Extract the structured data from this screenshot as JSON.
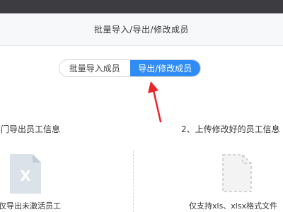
{
  "header": {
    "title": "批量导入/导出/修改成员"
  },
  "mode_switch": {
    "import_label": "批量导入成员",
    "export_label": "导出/修改成员",
    "active": "export"
  },
  "steps": {
    "step1_text": "部门导出员工信息",
    "step2_text": "2、上传修改好的员工信息"
  },
  "panels": {
    "export_icon_letter": "X",
    "export_caption": "仅导出未激活员工",
    "upload_caption": "仅支持xls、xlsx格式文件"
  },
  "colors": {
    "accent": "#2f8cf4",
    "arrow": "#e8262a",
    "topbar": "#3d3d41"
  },
  "icons": {
    "export": "excel-file-icon",
    "upload": "blank-file-icon",
    "annotation": "red-arrow-icon"
  }
}
